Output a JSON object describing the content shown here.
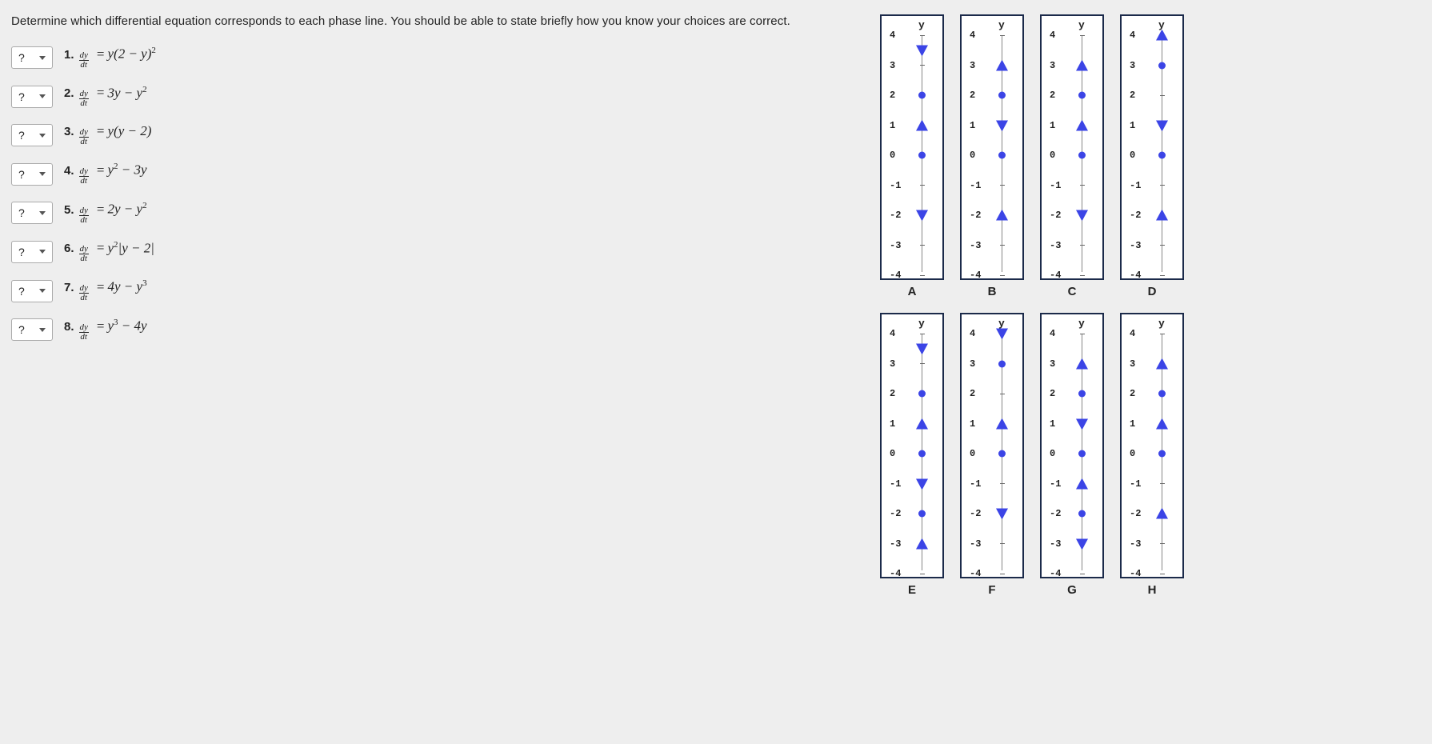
{
  "prompt": "Determine which differential equation corresponds to each phase line. You should be able to state briefly how you know your choices are correct.",
  "selector_placeholder": "?",
  "frac": {
    "top": "dy",
    "bot": "dt"
  },
  "equations": [
    {
      "num": "1.",
      "rhs": "y(2 − y)²"
    },
    {
      "num": "2.",
      "rhs": "3y − y²"
    },
    {
      "num": "3.",
      "rhs": "y(y − 2)"
    },
    {
      "num": "4.",
      "rhs": "y² − 3y"
    },
    {
      "num": "5.",
      "rhs": "2y − y²"
    },
    {
      "num": "6.",
      "rhs": "y²|y − 2|"
    },
    {
      "num": "7.",
      "rhs": "4y − y³"
    },
    {
      "num": "8.",
      "rhs": "y³ − 4y"
    }
  ],
  "axis_label": "y",
  "ticks": [
    4,
    3,
    2,
    1,
    0,
    -1,
    -2,
    -3,
    -4
  ],
  "chart_data": [
    {
      "label": "A",
      "type": "phase-line",
      "ylim": [
        -4,
        4
      ],
      "equilibria": [
        0,
        2
      ],
      "arrows": [
        {
          "at": 3.5,
          "dir": "down"
        },
        {
          "at": 1,
          "dir": "up"
        },
        {
          "at": -2,
          "dir": "down"
        }
      ]
    },
    {
      "label": "B",
      "type": "phase-line",
      "ylim": [
        -4,
        4
      ],
      "equilibria": [
        0,
        2
      ],
      "arrows": [
        {
          "at": 3,
          "dir": "up"
        },
        {
          "at": 1,
          "dir": "down"
        },
        {
          "at": -2,
          "dir": "up"
        }
      ]
    },
    {
      "label": "C",
      "type": "phase-line",
      "ylim": [
        -4,
        4
      ],
      "equilibria": [
        0,
        2
      ],
      "arrows": [
        {
          "at": 3,
          "dir": "up"
        },
        {
          "at": 1,
          "dir": "up"
        },
        {
          "at": -2,
          "dir": "down"
        }
      ]
    },
    {
      "label": "D",
      "type": "phase-line",
      "ylim": [
        -4,
        4
      ],
      "equilibria": [
        0,
        3
      ],
      "arrows": [
        {
          "at": 4,
          "dir": "up"
        },
        {
          "at": 1,
          "dir": "down"
        },
        {
          "at": -2,
          "dir": "up"
        }
      ]
    },
    {
      "label": "E",
      "type": "phase-line",
      "ylim": [
        -4,
        4
      ],
      "equilibria": [
        -2,
        0,
        2
      ],
      "arrows": [
        {
          "at": 3.5,
          "dir": "down"
        },
        {
          "at": 1,
          "dir": "up"
        },
        {
          "at": -1,
          "dir": "down"
        },
        {
          "at": -3,
          "dir": "up"
        }
      ]
    },
    {
      "label": "F",
      "type": "phase-line",
      "ylim": [
        -4,
        4
      ],
      "equilibria": [
        0,
        3
      ],
      "arrows": [
        {
          "at": 4,
          "dir": "down"
        },
        {
          "at": 1,
          "dir": "up"
        },
        {
          "at": -2,
          "dir": "down"
        }
      ]
    },
    {
      "label": "G",
      "type": "phase-line",
      "ylim": [
        -4,
        4
      ],
      "equilibria": [
        -2,
        0,
        2
      ],
      "arrows": [
        {
          "at": 3,
          "dir": "up"
        },
        {
          "at": 1,
          "dir": "down"
        },
        {
          "at": -1,
          "dir": "up"
        },
        {
          "at": -3,
          "dir": "down"
        }
      ]
    },
    {
      "label": "H",
      "type": "phase-line",
      "ylim": [
        -4,
        4
      ],
      "equilibria": [
        0,
        2
      ],
      "arrows": [
        {
          "at": 3,
          "dir": "up"
        },
        {
          "at": 1,
          "dir": "up"
        },
        {
          "at": -2,
          "dir": "up"
        }
      ]
    }
  ]
}
